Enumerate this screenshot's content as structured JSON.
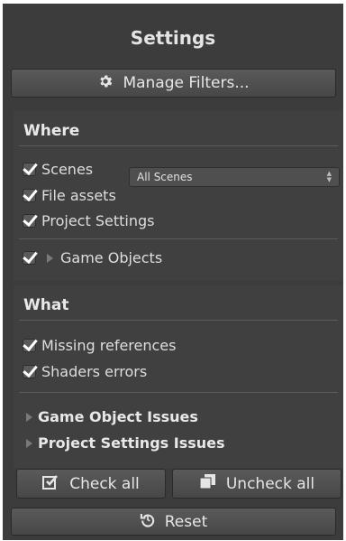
{
  "title": "Settings",
  "manage_filters": {
    "label": "Manage Filters...",
    "icon": "gear-icon"
  },
  "where": {
    "heading": "Where",
    "scenes_label": "Scenes",
    "scenes_dropdown_value": "All Scenes",
    "file_assets_label": "File assets",
    "project_settings_label": "Project Settings",
    "game_objects_label": "Game Objects"
  },
  "what": {
    "heading": "What",
    "missing_references_label": "Missing references",
    "shaders_errors_label": "Shaders errors"
  },
  "issues": {
    "game_object_issues": "Game Object Issues",
    "project_settings_issues": "Project Settings Issues"
  },
  "buttons": {
    "check_all": "Check all",
    "uncheck_all": "Uncheck all",
    "reset": "Reset"
  },
  "colors": {
    "panel": "#3c3c3c",
    "section": "#404040",
    "button": "#4f4f4f",
    "text": "#dcdcdc"
  }
}
